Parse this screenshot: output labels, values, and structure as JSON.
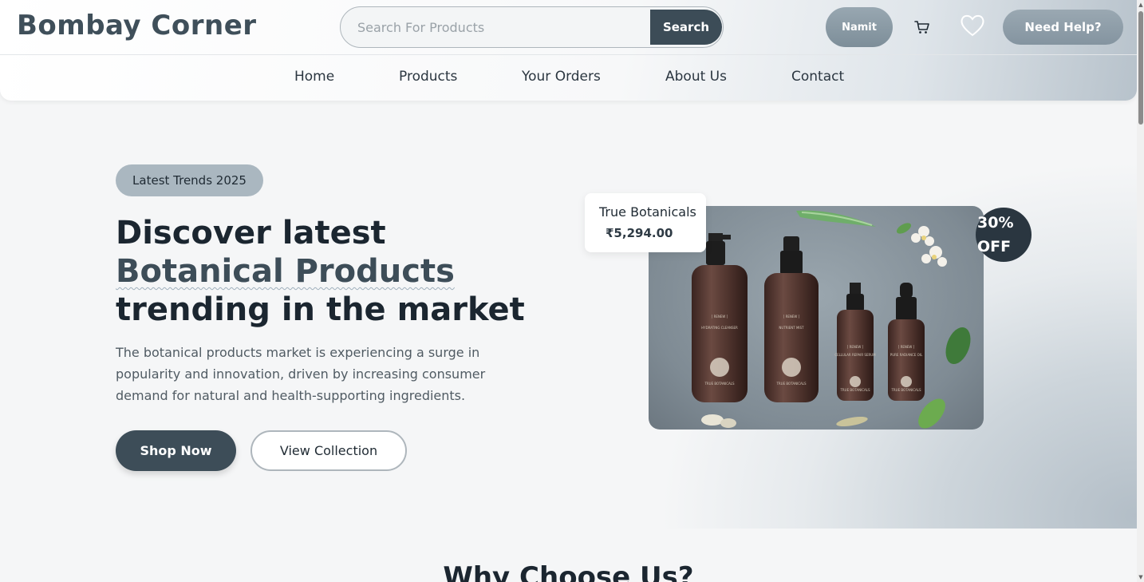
{
  "header": {
    "brand": "Bombay Corner",
    "search_placeholder": "Search For Products",
    "search_button": "Search",
    "user_name": "Namit",
    "help_button": "Need Help?",
    "cart_icon": "cart-icon",
    "wishlist_icon": "heart-icon"
  },
  "nav": {
    "items": [
      {
        "label": "Home"
      },
      {
        "label": "Products"
      },
      {
        "label": "Your Orders"
      },
      {
        "label": "About Us"
      },
      {
        "label": "Contact"
      }
    ]
  },
  "hero": {
    "badge": "Latest Trends 2025",
    "headline_1": "Discover latest",
    "headline_highlight": "Botanical Products",
    "headline_2": "trending in the market",
    "description": "The botanical products market is experiencing a surge in popularity and innovation, driven by increasing consumer demand for natural and health-supporting ingredients.",
    "primary_button": "Shop Now",
    "secondary_button": "View Collection"
  },
  "featured_product": {
    "name": "True Botanicals",
    "price": "₹5,294.00",
    "discount": "30% OFF",
    "bottle_labels": [
      "HYDRATING CLEANSER",
      "NUTRIENT MIST",
      "CELLULAR REPAIR SERUM",
      "PURE RADIANCE OIL"
    ],
    "bottle_brand": "TRUE BOTANICALS",
    "bottle_series": "[ RENEW ]"
  },
  "section": {
    "title": "Why Choose Us?"
  },
  "colors": {
    "primary": "#3d4d58",
    "accent": "#aab7c0",
    "text": "#1b2630"
  }
}
